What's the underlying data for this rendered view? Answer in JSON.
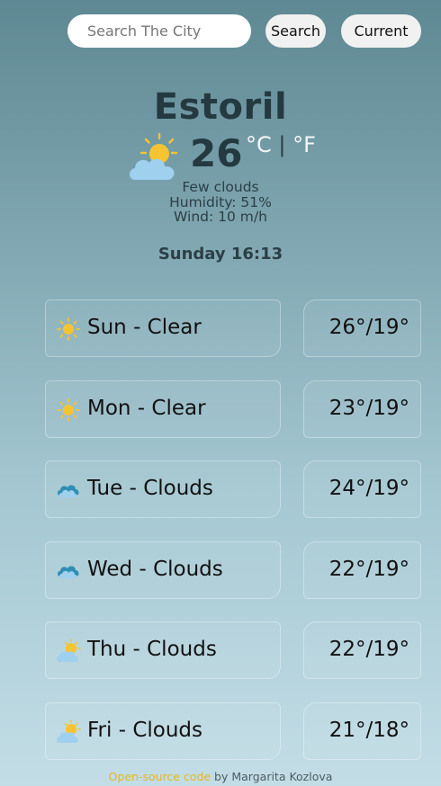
{
  "search": {
    "placeholder": "Search The City",
    "value": "",
    "button": "Search",
    "current_button": "Current"
  },
  "weather": {
    "city": "Estoril",
    "temperature": "26",
    "unit_c": "°C",
    "separator": "|",
    "unit_f": "°F",
    "icon": "sun-cloud-icon",
    "description": "Few clouds",
    "humidity": "Humidity: 51%",
    "wind": "Wind: 10 m/h",
    "datetime": "Sunday 16:13"
  },
  "forecast": [
    {
      "label": "Sun - Clear",
      "range": "26°/19°",
      "icon": "sun-icon"
    },
    {
      "label": "Mon - Clear",
      "range": "23°/19°",
      "icon": "sun-icon"
    },
    {
      "label": "Tue - Clouds",
      "range": "24°/19°",
      "icon": "cloud-icon"
    },
    {
      "label": "Wed - Clouds",
      "range": "22°/19°",
      "icon": "cloud-icon"
    },
    {
      "label": "Thu - Clouds",
      "range": "22°/19°",
      "icon": "sun-cloud-icon"
    },
    {
      "label": "Fri - Clouds",
      "range": "21°/18°",
      "icon": "sun-cloud-icon"
    }
  ],
  "footer": {
    "link": "Open-source code",
    "text": " by Margarita Kozlova"
  },
  "colors": {
    "sun": "#f6c431",
    "cloud_light": "#9fd0ee",
    "cloud_dark": "#2e8fb3",
    "link": "#e6b620"
  }
}
